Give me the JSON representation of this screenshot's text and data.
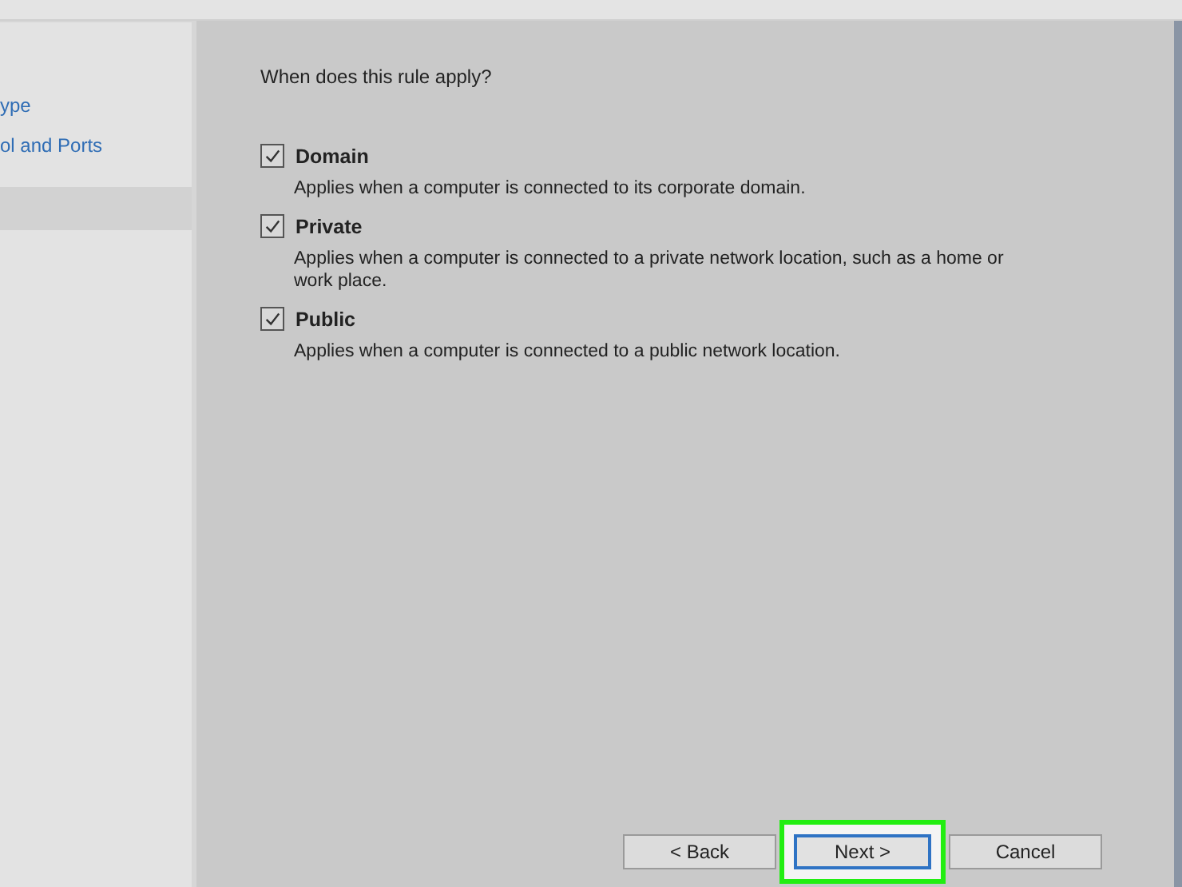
{
  "sidebar": {
    "items": [
      {
        "label": "ype",
        "selected": false
      },
      {
        "label": "ol and Ports",
        "selected": false
      },
      {
        "selected": true
      }
    ]
  },
  "question": "When does this rule apply?",
  "options": [
    {
      "label": "Domain",
      "checked": true,
      "description": "Applies when a computer is connected to its corporate domain."
    },
    {
      "label": "Private",
      "checked": true,
      "description": "Applies when a computer is connected to a private network location, such as a home or work place."
    },
    {
      "label": "Public",
      "checked": true,
      "description": "Applies when a computer is connected to a public network location."
    }
  ],
  "buttons": [
    {
      "label": "< Back",
      "default": false,
      "highlighted": false
    },
    {
      "label": "Next >",
      "default": true,
      "highlighted": true
    },
    {
      "label": "Cancel",
      "default": false,
      "highlighted": false
    }
  ]
}
